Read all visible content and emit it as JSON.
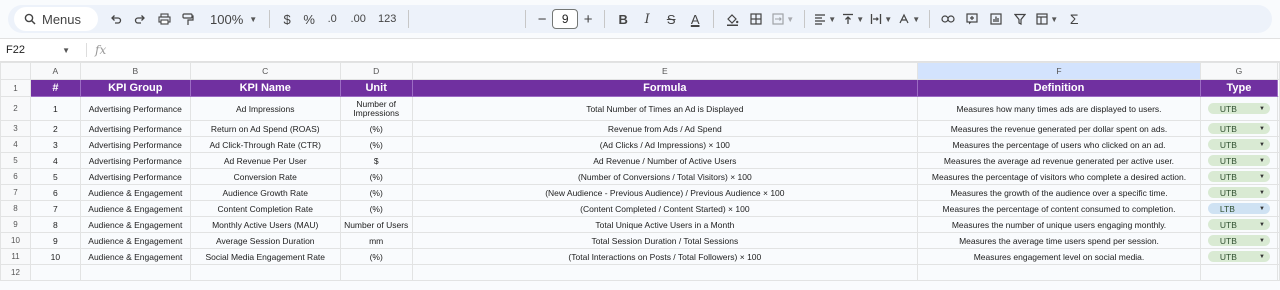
{
  "toolbar": {
    "menus_label": "Menus",
    "zoom": "100%",
    "currency": "$",
    "percent": "%",
    "dec_decrease": ".0",
    "dec_increase": ".00",
    "number_format": "123",
    "font_size": "9",
    "minus": "−",
    "plus": "+",
    "bold": "B",
    "italic": "I",
    "strike": "S",
    "text_color": "A",
    "sum": "Σ"
  },
  "formula_bar": {
    "cell_ref": "F22",
    "fx": "fx",
    "content": ""
  },
  "columns": [
    "A",
    "B",
    "C",
    "D",
    "E",
    "F",
    "G"
  ],
  "header": [
    "#",
    "KPI Group",
    "KPI Name",
    "Unit",
    "Formula",
    "Definition",
    "Type"
  ],
  "rows": [
    {
      "num": "1",
      "group": "Advertising Performance",
      "name": "Ad Impressions",
      "unit": "Number of Impressions",
      "formula": "Total Number of Times an Ad is Displayed",
      "definition": "Measures how many times ads are displayed to users.",
      "type": "UTB"
    },
    {
      "num": "2",
      "group": "Advertising Performance",
      "name": "Return on Ad Spend (ROAS)",
      "unit": "(%)",
      "formula": "Revenue from Ads / Ad Spend",
      "definition": "Measures the revenue generated per dollar spent on ads.",
      "type": "UTB"
    },
    {
      "num": "3",
      "group": "Advertising Performance",
      "name": "Ad Click-Through Rate (CTR)",
      "unit": "(%)",
      "formula": "(Ad Clicks / Ad Impressions) × 100",
      "definition": "Measures the percentage of users who clicked on an ad.",
      "type": "UTB"
    },
    {
      "num": "4",
      "group": "Advertising Performance",
      "name": "Ad Revenue Per User",
      "unit": "$",
      "formula": "Ad Revenue / Number of Active Users",
      "definition": "Measures the average ad revenue generated per active user.",
      "type": "UTB"
    },
    {
      "num": "5",
      "group": "Advertising Performance",
      "name": "Conversion Rate",
      "unit": "(%)",
      "formula": "(Number of Conversions / Total Visitors) × 100",
      "definition": "Measures the percentage of visitors who complete a desired action.",
      "type": "UTB"
    },
    {
      "num": "6",
      "group": "Audience & Engagement",
      "name": "Audience Growth Rate",
      "unit": "(%)",
      "formula": "(New Audience - Previous Audience) / Previous Audience × 100",
      "definition": "Measures the growth of the audience over a specific time.",
      "type": "UTB"
    },
    {
      "num": "7",
      "group": "Audience & Engagement",
      "name": "Content Completion Rate",
      "unit": "(%)",
      "formula": "(Content Completed / Content Started) × 100",
      "definition": "Measures the percentage of content consumed to completion.",
      "type": "LTB"
    },
    {
      "num": "8",
      "group": "Audience & Engagement",
      "name": "Monthly Active Users (MAU)",
      "unit": "Number of Users",
      "formula": "Total Unique Active Users in a Month",
      "definition": "Measures the number of unique users engaging monthly.",
      "type": "UTB"
    },
    {
      "num": "9",
      "group": "Audience & Engagement",
      "name": "Average Session Duration",
      "unit": "mm",
      "formula": "Total Session Duration / Total Sessions",
      "definition": "Measures the average time users spend per session.",
      "type": "UTB"
    },
    {
      "num": "10",
      "group": "Audience & Engagement",
      "name": "Social Media Engagement Rate",
      "unit": "(%)",
      "formula": "(Total Interactions on Posts / Total Followers) × 100",
      "definition": "Measures engagement level on social media.",
      "type": "UTB"
    }
  ],
  "row_numbers": [
    "1",
    "2",
    "3",
    "4",
    "5",
    "6",
    "7",
    "8",
    "9",
    "10",
    "11",
    "12"
  ],
  "colors": {
    "header_bg": "#7030a0",
    "utb_chip": "#d9ead3",
    "ltb_chip": "#cfe2f3"
  }
}
